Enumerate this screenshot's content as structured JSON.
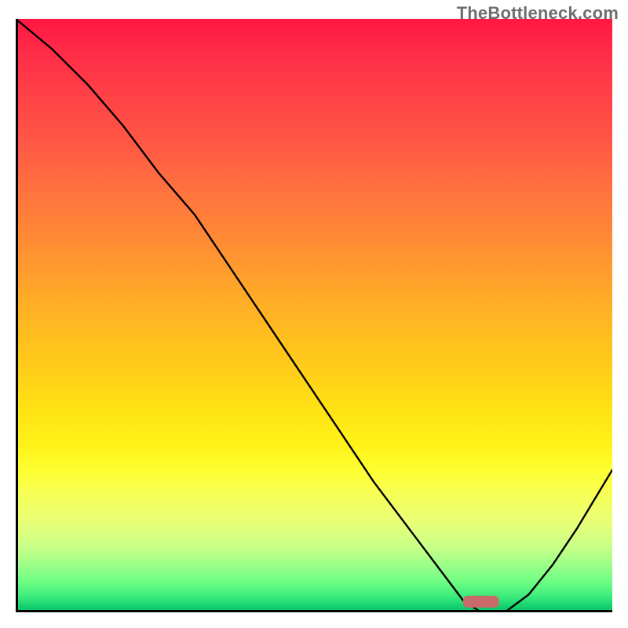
{
  "watermark": "TheBottleneck.com",
  "colors": {
    "curve": "#000000",
    "marker": "#c96a6a",
    "axis": "#000000"
  },
  "chart_data": {
    "type": "line",
    "title": "",
    "xlabel": "",
    "ylabel": "",
    "xlim": [
      0,
      100
    ],
    "ylim": [
      0,
      100
    ],
    "x": [
      0,
      6,
      12,
      18,
      24,
      30,
      36,
      42,
      48,
      54,
      60,
      66,
      72,
      75,
      78,
      82,
      86,
      90,
      94,
      100
    ],
    "values": [
      100,
      95,
      89,
      82,
      74,
      67,
      58,
      49,
      40,
      31,
      22,
      14,
      6,
      2,
      0,
      0,
      3,
      8,
      14,
      24
    ],
    "marker": {
      "x": 78,
      "y": 0,
      "width": 6,
      "height": 2,
      "color": "#c96a6a"
    },
    "gradient_stops": [
      {
        "pos": 0.0,
        "color": "#ff1744"
      },
      {
        "pos": 0.2,
        "color": "#ff5545"
      },
      {
        "pos": 0.4,
        "color": "#ff8e33"
      },
      {
        "pos": 0.6,
        "color": "#ffd018"
      },
      {
        "pos": 0.78,
        "color": "#fdff40"
      },
      {
        "pos": 0.9,
        "color": "#b4ff86"
      },
      {
        "pos": 1.0,
        "color": "#0bbf65"
      }
    ]
  }
}
